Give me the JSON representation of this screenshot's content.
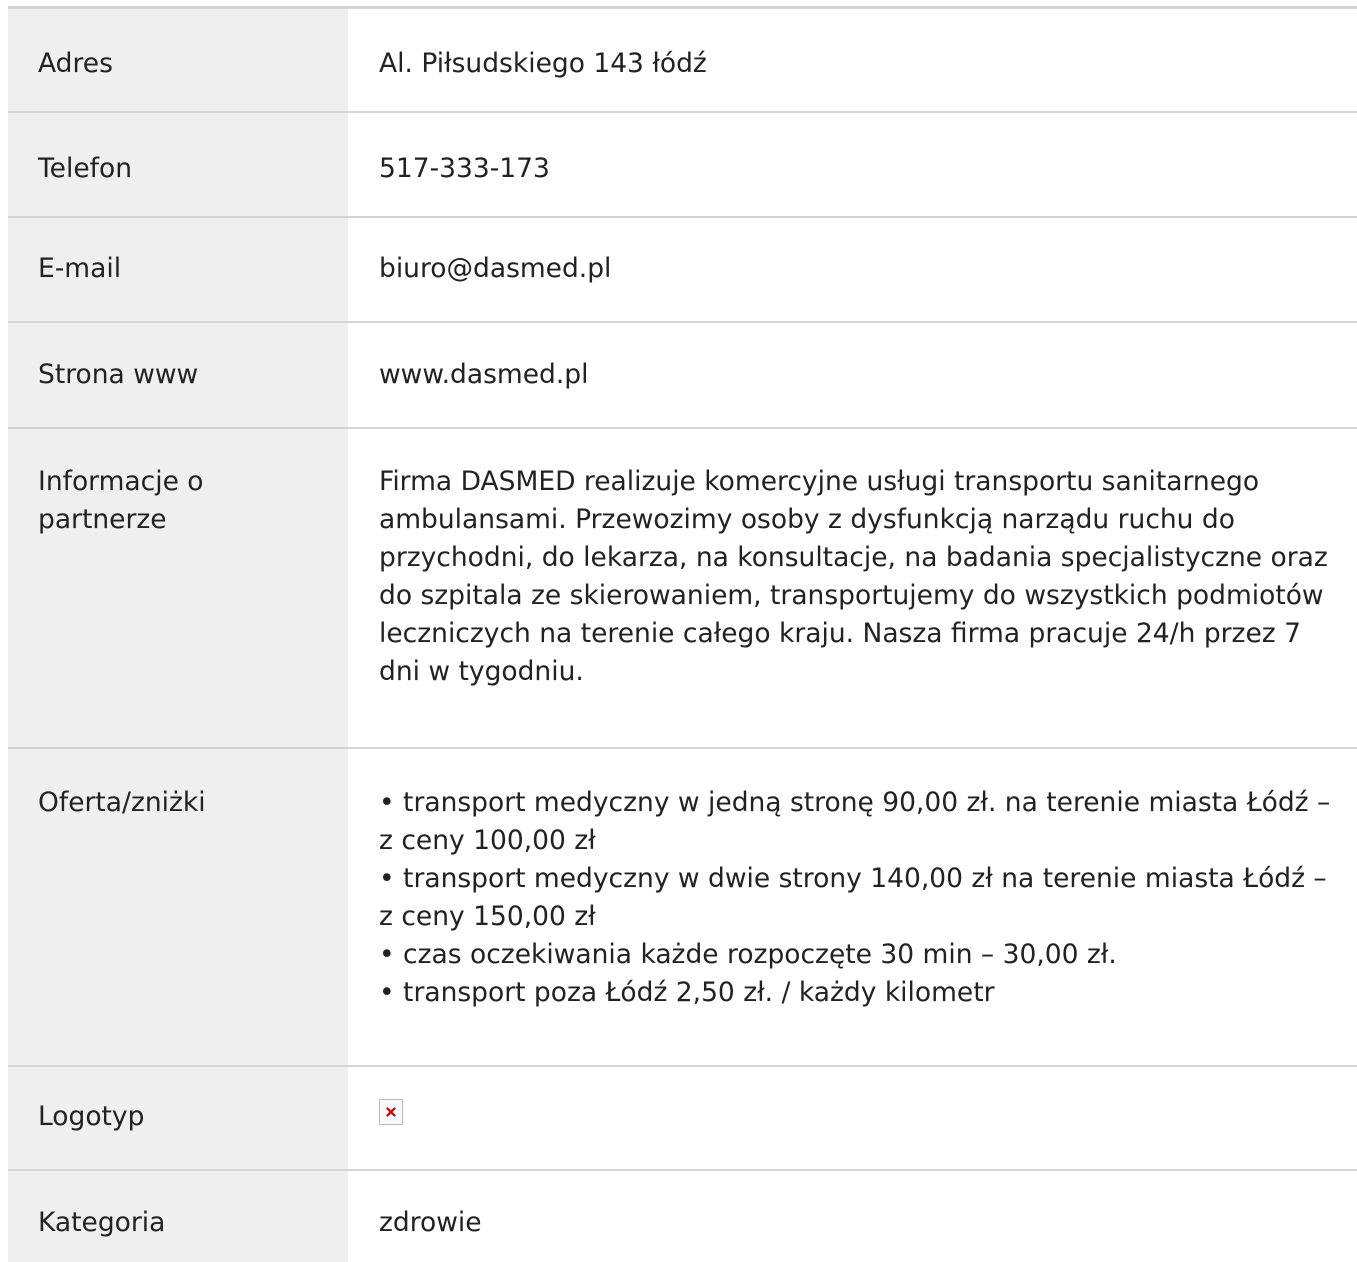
{
  "rows": [
    {
      "label": "Adres",
      "value": "Al. Piłsudskiego 143 łódź"
    },
    {
      "label": "Telefon",
      "value": "517-333-173"
    },
    {
      "label": "E-mail",
      "value": "biuro@dasmed.pl"
    },
    {
      "label": "Strona www",
      "value": "www.dasmed.pl"
    },
    {
      "label": "Informacje o partnerze",
      "value": "Firma DASMED realizuje komercyjne usługi transportu sanitarnego ambulansami. Przewozimy osoby z dysfunkcją narządu ruchu do przychodni, do lekarza, na konsultacje, na badania specjalistyczne oraz do szpitala ze skierowaniem, transportujemy do wszystkich podmiotów leczniczych na terenie całego kraju. Nasza firma pracuje 24/h przez 7 dni w tygodniu."
    },
    {
      "label": "Oferta/zniżki",
      "lines": [
        "• transport medyczny w jedną stronę 90,00 zł. na terenie miasta Łódź – z ceny 100,00 zł",
        "• transport medyczny w dwie strony 140,00 zł na terenie miasta Łódź – z ceny 150,00 zł",
        "• czas oczekiwania każde rozpoczęte 30 min – 30,00 zł.",
        "• transport poza Łódź 2,50 zł. / każdy kilometr"
      ]
    },
    {
      "label": "Logotyp",
      "icon": "broken-image-icon"
    },
    {
      "label": "Kategoria",
      "value": "zdrowie"
    }
  ],
  "colors": {
    "label_background": "#efefef",
    "border": "#d4d4d4",
    "text": "#222222",
    "broken_image_x": "#cc0000"
  }
}
